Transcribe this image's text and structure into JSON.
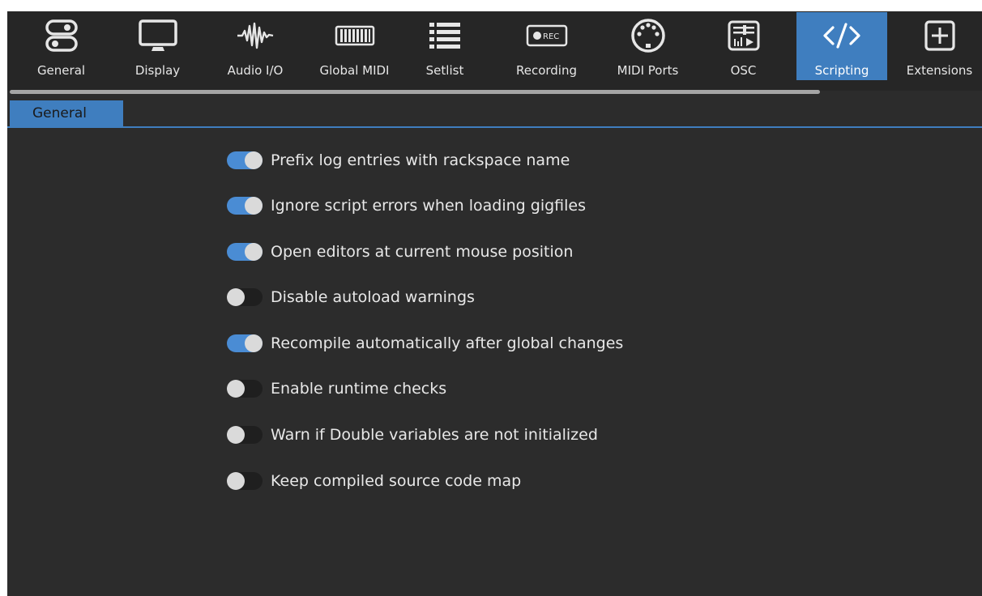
{
  "toolbar": {
    "items": [
      {
        "label": "General",
        "icon": "toggles-icon"
      },
      {
        "label": "Display",
        "icon": "monitor-icon"
      },
      {
        "label": "Audio I/O",
        "icon": "waveform-icon"
      },
      {
        "label": "Global MIDI",
        "icon": "keyboard-icon"
      },
      {
        "label": "Setlist",
        "icon": "list-icon"
      },
      {
        "label": "Recording",
        "icon": "record-icon",
        "icon_text": "REC"
      },
      {
        "label": "MIDI Ports",
        "icon": "midi-port-icon"
      },
      {
        "label": "OSC",
        "icon": "osc-icon"
      },
      {
        "label": "Scripting",
        "icon": "code-icon",
        "active": true
      },
      {
        "label": "Extensions",
        "icon": "plus-box-icon"
      }
    ]
  },
  "tabs": [
    {
      "label": "General",
      "active": true
    }
  ],
  "options": [
    {
      "label": "Prefix log entries with rackspace name",
      "enabled": true
    },
    {
      "label": "Ignore script errors when loading gigfiles",
      "enabled": true
    },
    {
      "label": "Open editors at current mouse position",
      "enabled": true
    },
    {
      "label": "Disable autoload warnings",
      "enabled": false
    },
    {
      "label": "Recompile automatically after global changes",
      "enabled": true
    },
    {
      "label": "Enable runtime checks",
      "enabled": false
    },
    {
      "label": "Warn if Double variables are not initialized",
      "enabled": false
    },
    {
      "label": "Keep compiled source code map",
      "enabled": false
    }
  ],
  "colors": {
    "accent": "#3f7ebf",
    "toggle_on": "#4a8cd4",
    "background": "#2c2c2c",
    "toolbar": "#262626"
  }
}
